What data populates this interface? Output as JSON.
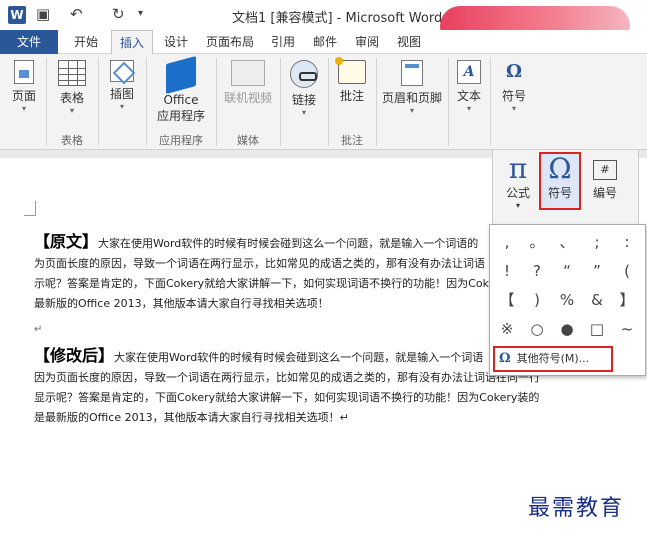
{
  "titlebar": {
    "app_icon": "W",
    "undo_glyph": "↶",
    "redo_glyph": "↻",
    "title": "文档1 [兼容模式] - Microsoft Word"
  },
  "tabs": [
    "文件",
    "开始",
    "插入",
    "设计",
    "页面布局",
    "引用",
    "邮件",
    "审阅",
    "视图"
  ],
  "active_tab": "插入",
  "ribbon": {
    "buttons": {
      "pages": "页面",
      "table": "表格",
      "pictures": "插图",
      "office_app_1": "Office",
      "office_app_2": "应用程序",
      "online_video": "联机视频",
      "links": "链接",
      "comment": "批注",
      "header_footer": "页眉和页脚",
      "text": "文本",
      "symbols": "符号"
    },
    "groups": {
      "tables": "表格",
      "apps": "应用程序",
      "media": "媒体",
      "comments": "批注"
    }
  },
  "mini_panel": {
    "equation_label": "公式",
    "equation_glyph": "π",
    "symbol_label": "符号",
    "symbol_glyph": "Ω",
    "number_label": "编号",
    "number_glyph": "#"
  },
  "symbols_dropdown": {
    "rows": [
      [
        ",",
        "。",
        "、",
        ";",
        ":"
      ],
      [
        "!",
        "?",
        "“",
        "”",
        "("
      ],
      [
        "【",
        ")",
        "%",
        "&",
        "】"
      ],
      [
        "※",
        "○",
        "●",
        "□",
        "~"
      ]
    ],
    "more_symbols": "其他符号(M)..."
  },
  "document": {
    "p1_head": "【原文】",
    "p1_line1": "大家在使用Word软件的时候有时候会碰到这么一个问题，就是输入一个词语的",
    "p1_line2": "为页面长度的原因，导致一个词语在两行显示，比如常见的成语之类的，那有没有办法让词语",
    "p1_line3": "示呢？答案是肯定的，下面Cokery就给大家讲解一下，如何实现词语不换行的功能！因为Cok",
    "p1_line4": "最新版的Office 2013，其他版本请大家自行寻找相关选项！",
    "p2_head": "【修改后】",
    "p2_line1": "大家在使用Word软件的时候有时候会碰到这么一个问题，就是输入一个词语",
    "p2_line2": "因为页面长度的原因，导致一个词语在两行显示，比如常见的成语之类的，那有没有办法让词语在同一行",
    "p2_line3": "显示呢？答案是肯定的，下面Cokery就给大家讲解一下，如何实现词语不换行的功能！因为Cokery装的",
    "p2_line4": "是最新版的Office 2013，其他版本请大家自行寻找相关选项！↵",
    "para_mark": "↵"
  },
  "watermark": "最需教育",
  "colors": {
    "accent": "#2b579a",
    "highlight_border": "#d22222",
    "watermark": "#1a2e8a"
  }
}
